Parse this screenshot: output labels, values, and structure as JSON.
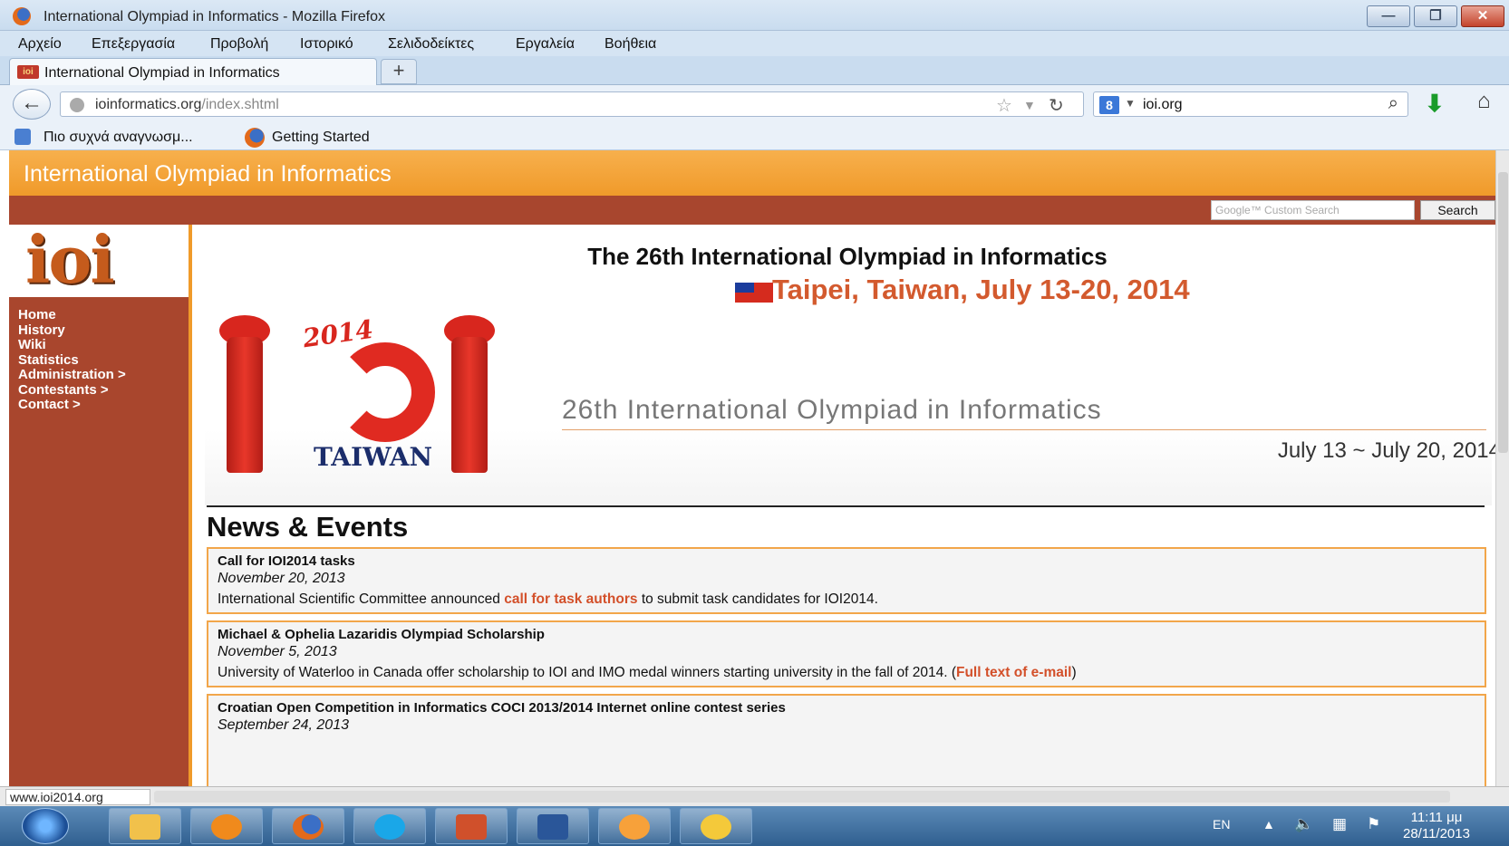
{
  "window": {
    "title": "International Olympiad in Informatics - Mozilla Firefox"
  },
  "menu": [
    "Αρχείο",
    "Επεξεργασία",
    "Προβολή",
    "Ιστορικό",
    "Σελιδοδείκτες",
    "Εργαλεία",
    "Βοήθεια"
  ],
  "tab": {
    "label": "International Olympiad in Informatics",
    "favicon": "ioi",
    "new_tab": "+"
  },
  "address": {
    "host": "ioinformatics.org",
    "path": "/index.shtml"
  },
  "search": {
    "engine": "8",
    "value": "ioi.org"
  },
  "bookmarks": [
    "Πιο συχνά αναγνωσμ...",
    "Getting Started"
  ],
  "site": {
    "header": "International Olympiad in Informatics",
    "search_placeholder": "Google™ Custom Search",
    "search_button": "Search",
    "logo": "ioi",
    "nav": [
      "Home",
      "History",
      "Wiki",
      "Statistics",
      "Administration >",
      "Contestants >",
      "Contact >"
    ]
  },
  "banner": {
    "title": "The 26th International Olympiad in Informatics",
    "location": "Taipei, Taiwan, July 13-20, 2014",
    "emblem_year": "2014",
    "emblem_country": "TAIWAN",
    "subtitle": "26th International Olympiad in Informatics",
    "dates": "July 13 ~ July 20, 2014"
  },
  "news": {
    "heading": "News & Events",
    "items": [
      {
        "title": "Call for IOI2014 tasks",
        "date": "November 20, 2013",
        "pre": "International Scientific Committee announced ",
        "link": "call for task authors",
        "post": " to submit task candidates for IOI2014."
      },
      {
        "title": "Michael & Ophelia Lazaridis Olympiad Scholarship",
        "date": "November 5, 2013",
        "pre": "University of Waterloo in Canada offer scholarship to IOI and IMO medal winners starting university in the fall of 2014. (",
        "link": "Full text of e-mail",
        "post": ")"
      },
      {
        "title": "Croatian Open Competition in Informatics COCI 2013/2014 Internet online contest series",
        "date": "September 24, 2013",
        "pre": "",
        "link": "",
        "post": ""
      }
    ]
  },
  "status": {
    "url": "www.ioi2014.org"
  },
  "taskbar": {
    "lang": "EN",
    "time": "11:11 μμ",
    "date": "28/11/2013"
  },
  "colors": {
    "accent": "#f09a2a",
    "sidebar": "#a9462d",
    "link": "#d3502a"
  }
}
